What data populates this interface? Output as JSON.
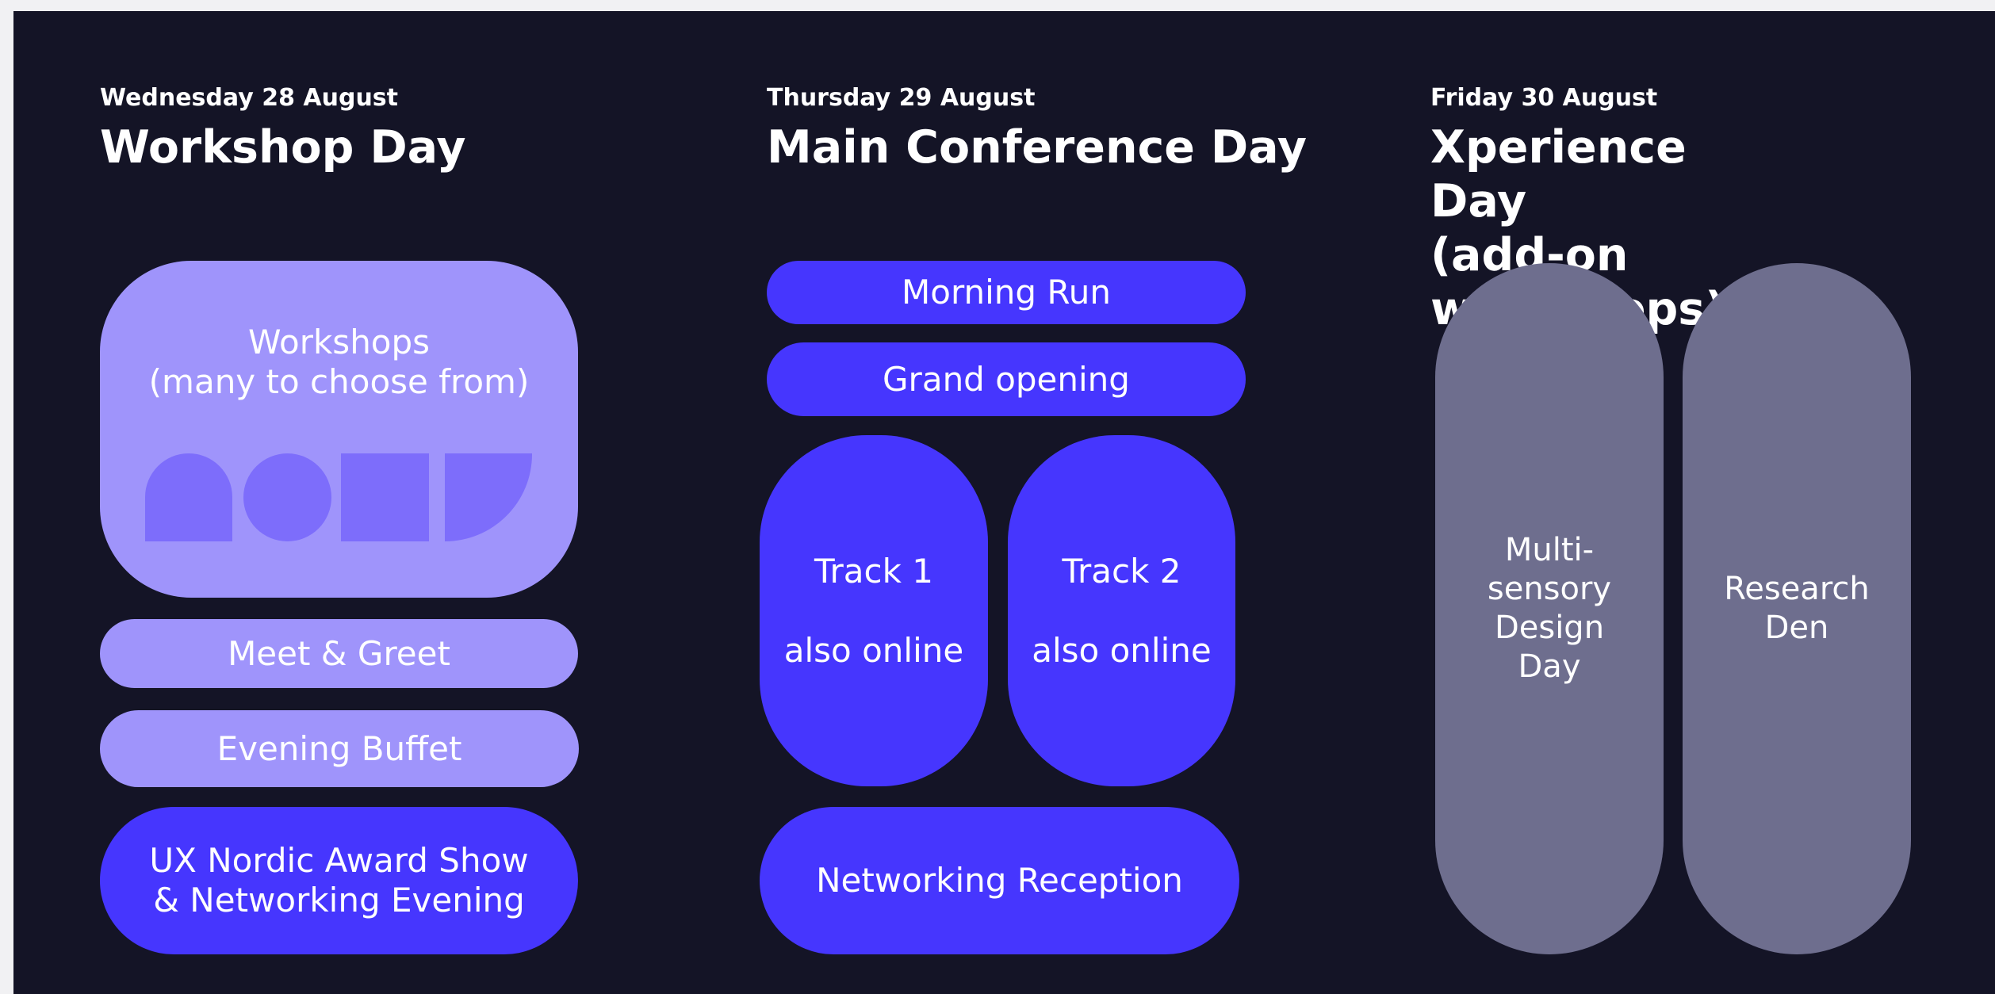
{
  "days": [
    {
      "date": "Wednesday 28 August",
      "title": "Workshop Day",
      "blocks": [
        {
          "label": "Workshops\n(many to choose from)"
        },
        {
          "label": "Meet & Greet"
        },
        {
          "label": "Evening Buffet"
        },
        {
          "label": "UX Nordic Award Show\n& Networking Evening"
        }
      ]
    },
    {
      "date": "Thursday 29 August",
      "title": "Main Conference Day",
      "blocks": [
        {
          "label": "Morning Run"
        },
        {
          "label": "Grand opening"
        },
        {
          "label": "Track 1\n\nalso online"
        },
        {
          "label": "Track 2\n\nalso online"
        },
        {
          "label": "Networking Reception"
        }
      ]
    },
    {
      "date": "Friday 30 August",
      "title": "Xperience Day\n(add-on workshops)",
      "blocks": [
        {
          "label": "Multi-\nsensory\nDesign\nDay"
        },
        {
          "label": "Research\nDen"
        }
      ]
    }
  ],
  "colors": {
    "background": "#141426",
    "workshop_blocks": "#9f94fb",
    "conference_blocks": "#4636fe",
    "xperience_blocks": "#6e6e8e",
    "shape_fill": "#7d6dfb",
    "text": "#ffffff"
  },
  "icons": [
    "arch-shape-icon",
    "circle-shape-icon",
    "square-shape-icon",
    "quarter-circle-shape-icon"
  ]
}
